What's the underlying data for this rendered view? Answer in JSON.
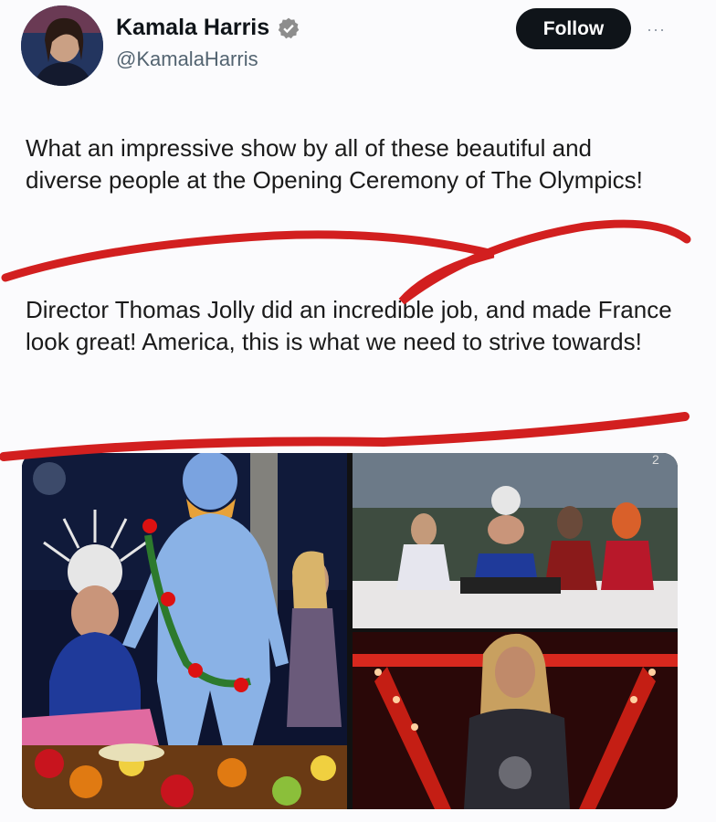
{
  "author": {
    "name": "Kamala Harris",
    "handle": "@KamalaHarris",
    "verified_icon": "verified-badge-icon"
  },
  "actions": {
    "follow_label": "Follow",
    "more_label": "···"
  },
  "tweet": {
    "paragraph_1": "What an impressive show by all of these beautiful and diverse people at the Opening Ceremony of The Olympics!",
    "paragraph_2": "Director Thomas Jolly did an incredible job, and made France look great! America, this is what we need to strive towards!"
  },
  "media": {
    "count_badge": "2",
    "images": [
      "blue-painted-performer-with-flowers",
      "performers-on-stage-with-halo-headdress",
      "performer-on-red-lit-bridge"
    ]
  },
  "colors": {
    "scribble": "#d21f1f",
    "follow_bg": "#0f1419",
    "verified": "#8d8d8d"
  }
}
